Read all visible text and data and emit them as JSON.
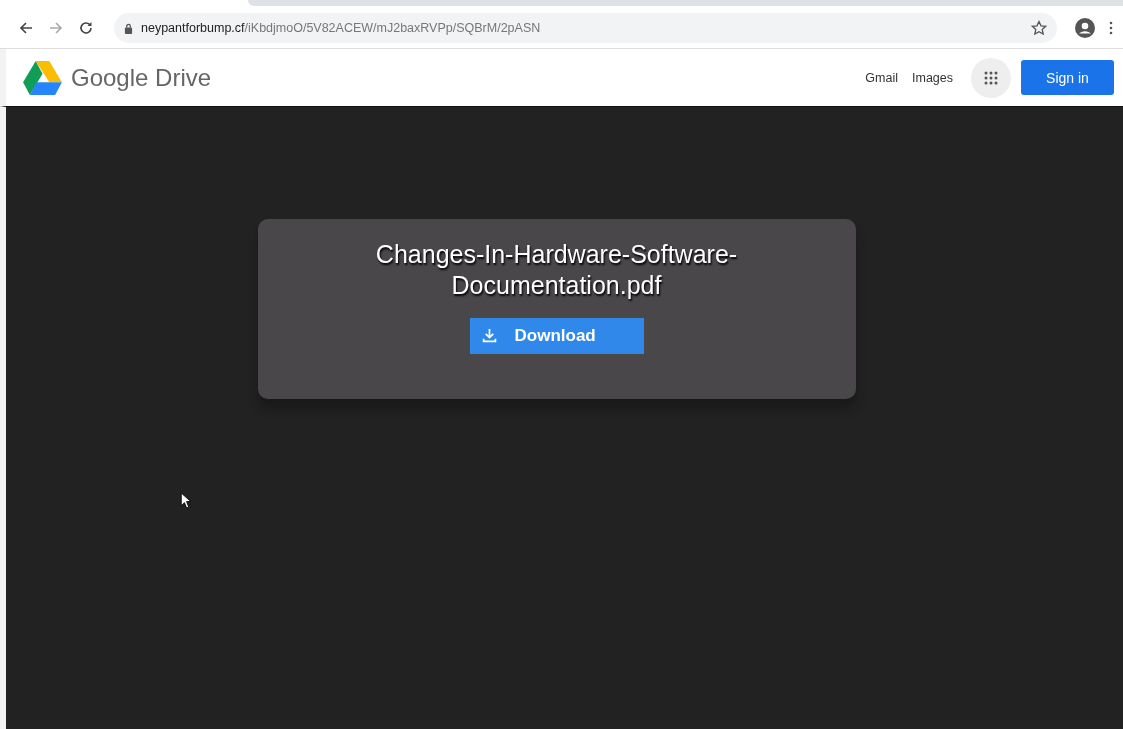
{
  "browser": {
    "url_host": "neypantforbump.cf",
    "url_path": "/iKbdjmoO/5V82ACEW/mJ2baxRVPp/SQBrM/2pASN",
    "forward_disabled": true
  },
  "header": {
    "logo_text": "Google Drive",
    "links": [
      "Gmail",
      "Images"
    ],
    "sign_in": "Sign in"
  },
  "file_card": {
    "title": "Changes-In-Hardware-Software-Documentation.pdf",
    "button": "Download"
  }
}
